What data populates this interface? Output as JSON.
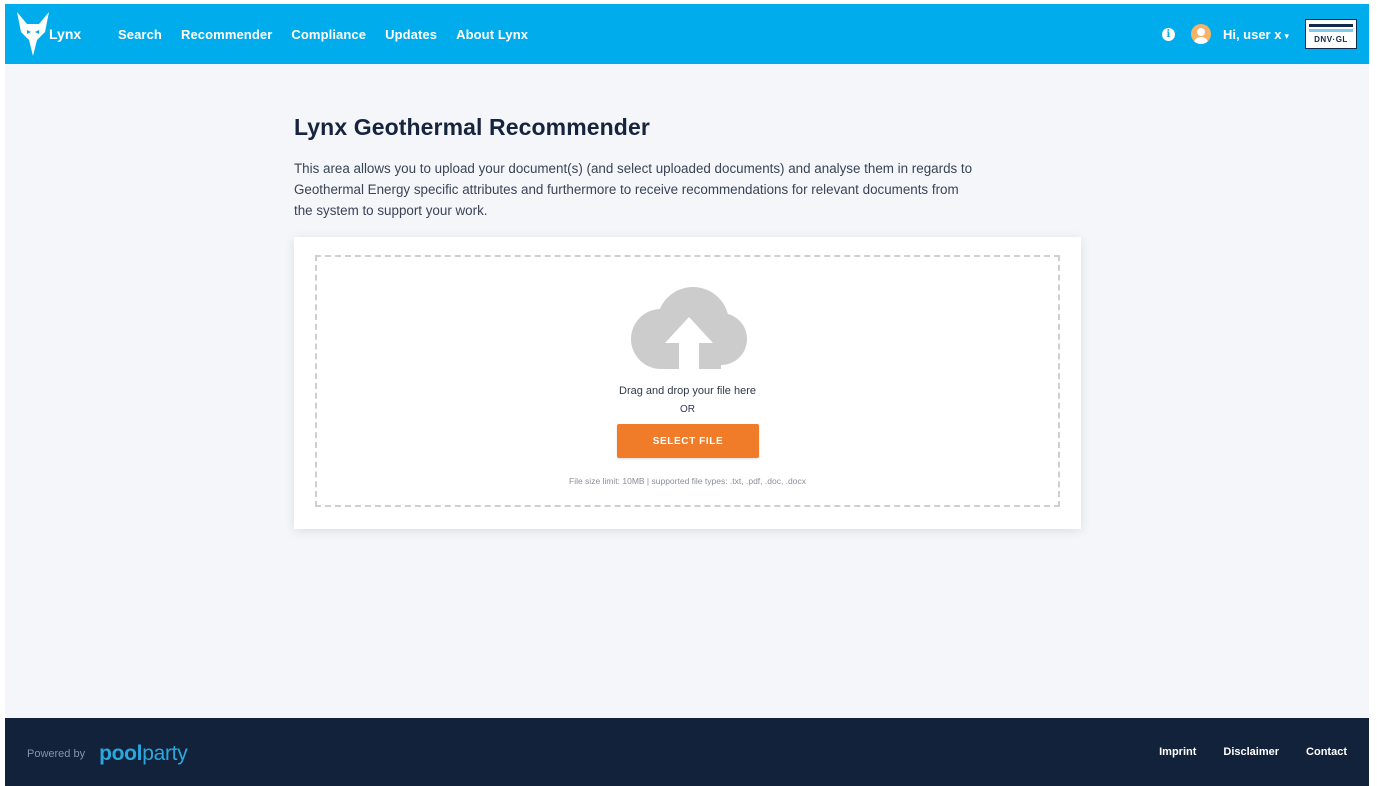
{
  "header": {
    "logo_text": "Lynx",
    "nav": [
      "Search",
      "Recommender",
      "Compliance",
      "Updates",
      "About Lynx"
    ],
    "info_icon": "i",
    "user_label": "Hi, user x",
    "user_caret": "▾",
    "partner_logo_text": "DNV·GL"
  },
  "main": {
    "title": "Lynx Geothermal Recommender",
    "description": "This area allows you to upload your document(s) (and select uploaded documents) and analyse them in regards to Geothermal Energy specific attributes and furthermore to receive recommendations for relevant documents from the system to support your work."
  },
  "upload": {
    "icon": "cloud-upload-icon",
    "drag_text": "Drag and drop your file here",
    "or_text": "OR",
    "button_label": "SELECT FILE",
    "limit_text": "File size limit: 10MB | supported file types: .txt, .pdf, .doc, .docx"
  },
  "footer": {
    "powered_by": "Powered by",
    "brand_part1": "pool",
    "brand_part2": "party",
    "links": [
      "Imprint",
      "Disclaimer",
      "Contact"
    ]
  },
  "colors": {
    "header_bg": "#00acec",
    "footer_bg": "#12223b",
    "accent_button": "#f07c2a",
    "page_bg": "#f4f6fa"
  }
}
